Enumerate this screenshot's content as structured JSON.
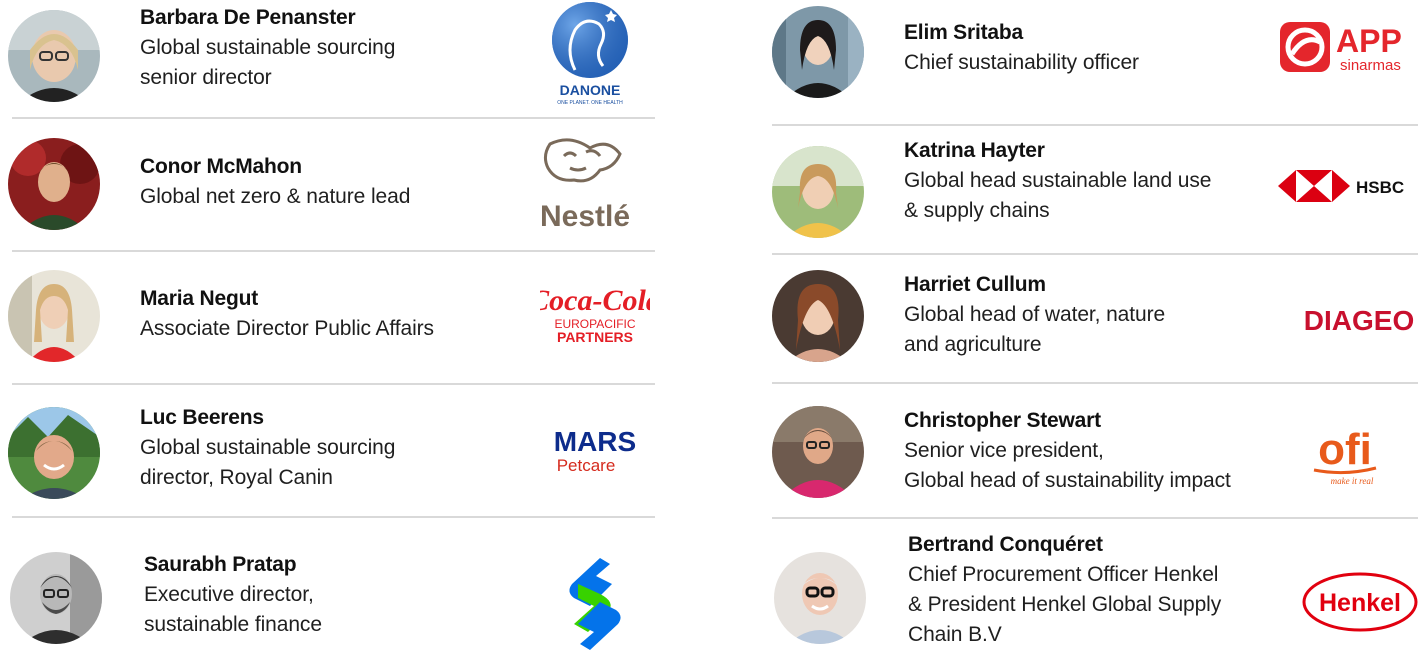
{
  "left": [
    {
      "name": "Barbara De Penanster",
      "role": [
        "Global sustainable sourcing",
        "senior director"
      ],
      "logo": {
        "text": "DANONE",
        "tagline": "ONE PLANET. ONE HEALTH",
        "color": "#1a4fa0"
      }
    },
    {
      "name": "Conor McMahon",
      "role": [
        "Global net zero & nature lead"
      ],
      "logo": {
        "text": "Nestlé",
        "color": "#7a6a5a"
      }
    },
    {
      "name": "Maria Negut",
      "role": [
        "Associate Director Public Affairs"
      ],
      "logo": {
        "text": "Coca-Cola",
        "line2": "EUROPACIFIC",
        "line3": "PARTNERS",
        "color": "#e41e26"
      }
    },
    {
      "name": "Luc Beerens",
      "role": [
        "Global sustainable sourcing",
        "director, Royal Canin"
      ],
      "logo": {
        "text": "MARS",
        "line2": "Petcare",
        "color": "#0d2c8c",
        "accent": "#d52b1e"
      }
    },
    {
      "name": "Saurabh Pratap",
      "role": [
        "Executive director,",
        "sustainable finance"
      ],
      "logo": {
        "text": "standard-chartered-logo",
        "color": "#0473ea",
        "accent": "#38d200"
      }
    }
  ],
  "right": [
    {
      "name": "Elim Sritaba",
      "role": [
        "Chief sustainability officer"
      ],
      "logo": {
        "text": "APP",
        "line2": "sinarmas",
        "color": "#e4262c"
      }
    },
    {
      "name": "Katrina Hayter",
      "role": [
        "Global head sustainable land use",
        "& supply chains"
      ],
      "logo": {
        "text": "HSBC",
        "color": "#db0011"
      }
    },
    {
      "name": "Harriet Cullum",
      "role": [
        "Global head of water, nature",
        "and agriculture"
      ],
      "logo": {
        "text": "DIAGEO",
        "color": "#c8102e"
      }
    },
    {
      "name": "Christopher Stewart",
      "role": [
        "Senior vice president,",
        "Global head of sustainability impact"
      ],
      "logo": {
        "text": "ofi",
        "line2": "make it real",
        "color": "#e85a1b"
      }
    },
    {
      "name": "Bertrand Conquéret",
      "role": [
        "Chief Procurement Officer Henkel",
        "& President Henkel Global Supply",
        "Chain B.V"
      ],
      "logo": {
        "text": "Henkel",
        "color": "#e1000f"
      }
    }
  ]
}
